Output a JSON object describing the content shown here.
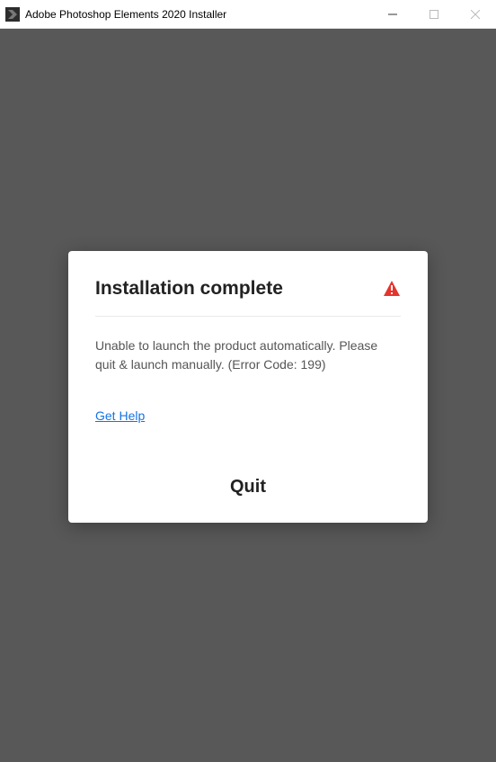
{
  "window": {
    "title": "Adobe Photoshop Elements 2020 Installer"
  },
  "dialog": {
    "title": "Installation complete",
    "message": "Unable to launch the product automatically. Please quit & launch manually. (Error Code: 199)",
    "help_link": "Get Help",
    "quit_label": "Quit"
  }
}
